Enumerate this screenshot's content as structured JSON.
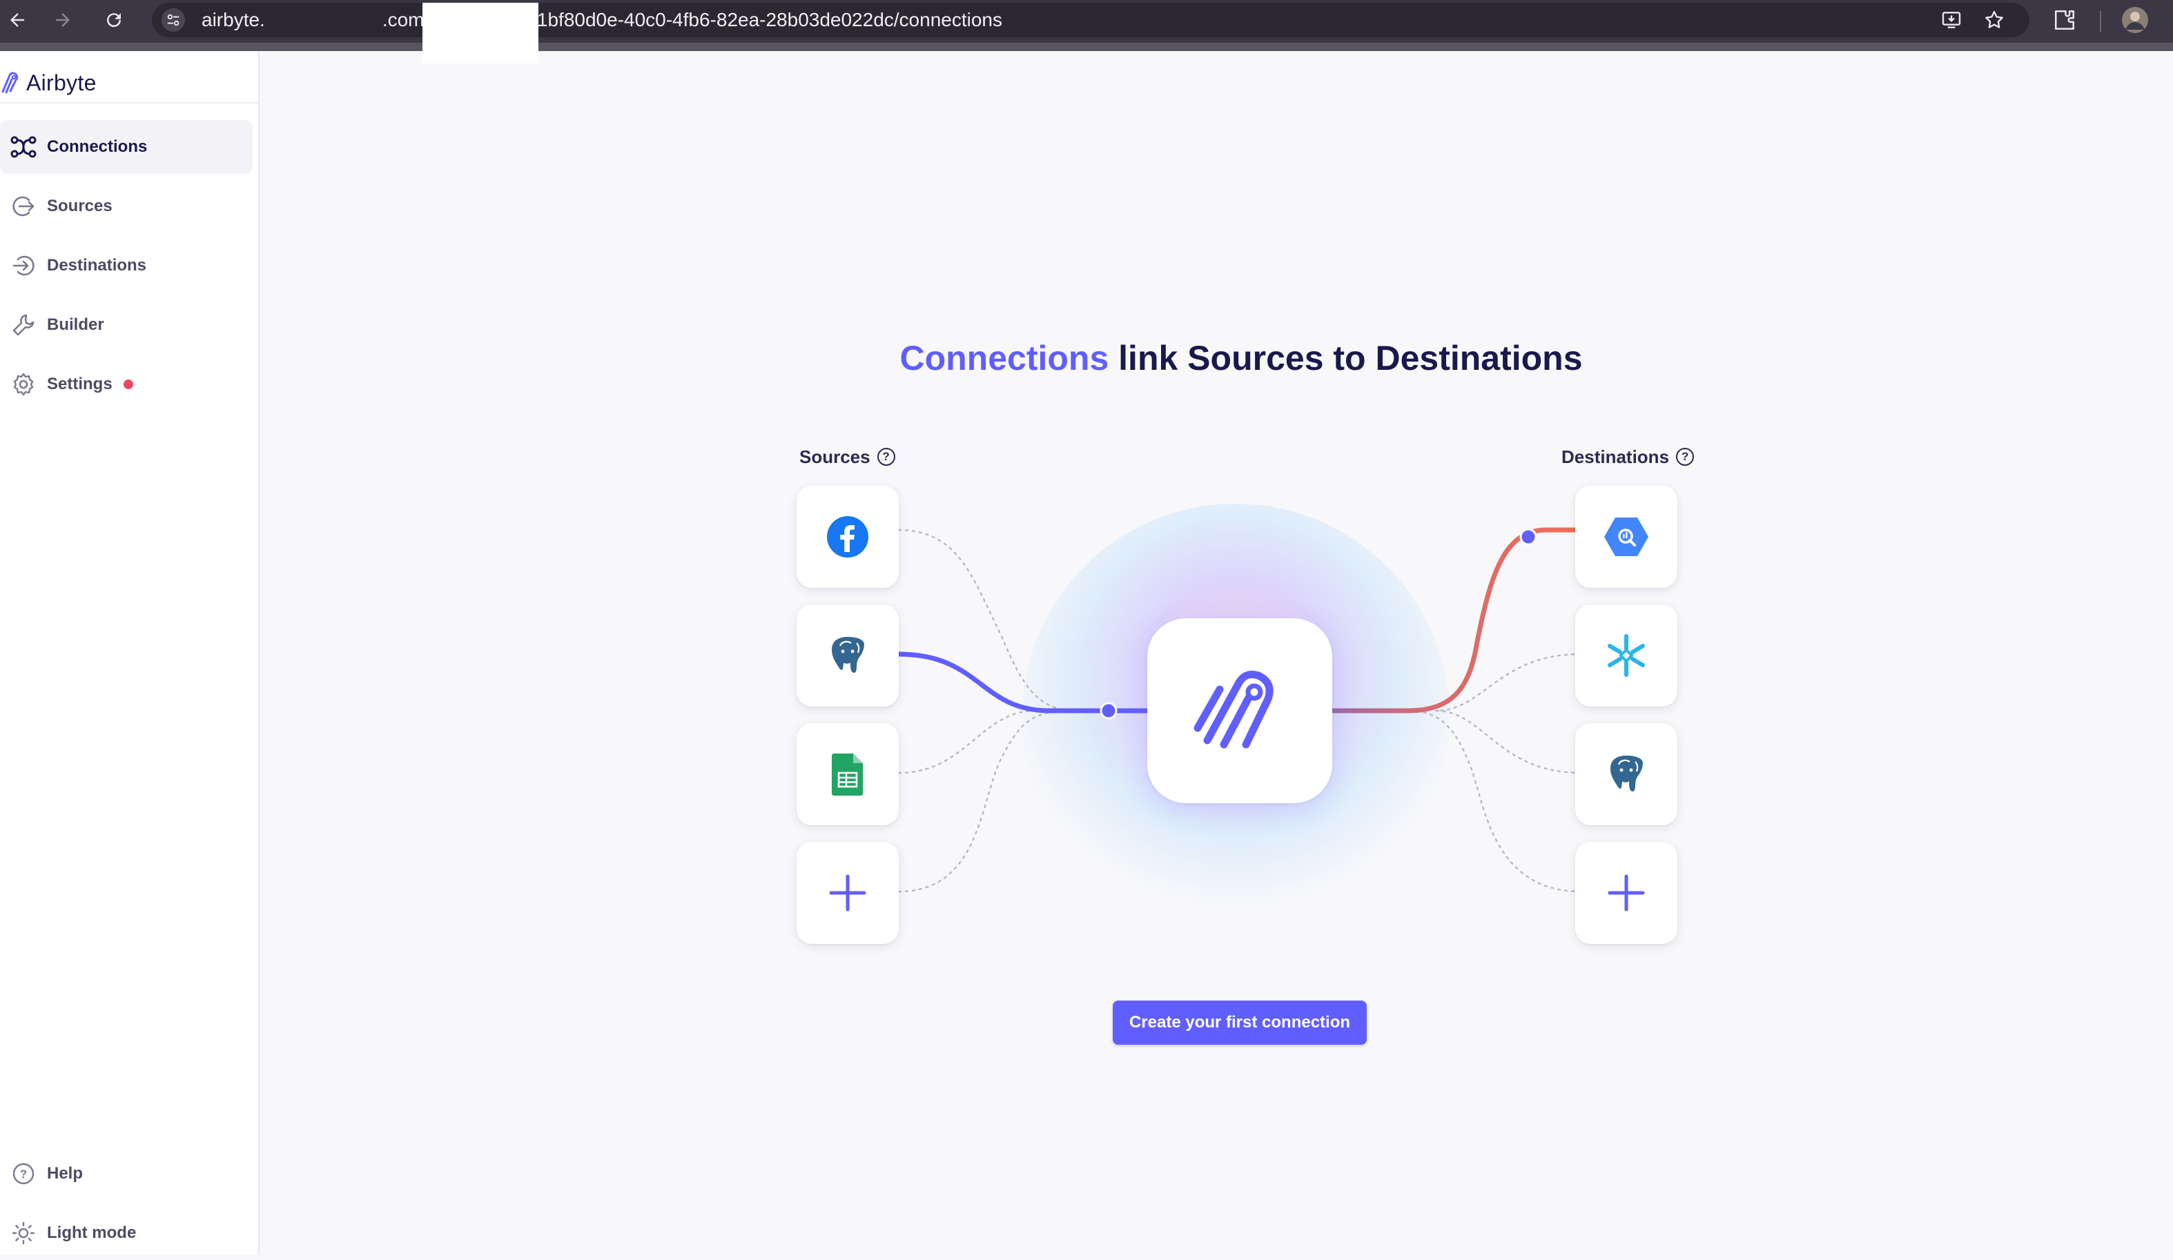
{
  "browser": {
    "url_host": "airbyte.",
    "url_path": ".com/workspaces/1bf80d0e-40c0-4fb6-82ea-28b03de022dc/connections",
    "icons": [
      "back-icon",
      "forward-icon",
      "reload-icon",
      "site-settings-icon",
      "install-app-icon",
      "bookmark-star-icon",
      "extensions-icon",
      "profile-avatar-icon"
    ]
  },
  "sidebar": {
    "brand": "Airbyte",
    "items": [
      {
        "label": "Connections",
        "icon": "connections-icon",
        "active": true
      },
      {
        "label": "Sources",
        "icon": "sources-icon"
      },
      {
        "label": "Destinations",
        "icon": "destinations-icon"
      },
      {
        "label": "Builder",
        "icon": "builder-icon"
      },
      {
        "label": "Settings",
        "icon": "settings-icon",
        "badge": "notification-dot"
      }
    ],
    "footer": [
      {
        "label": "Help",
        "icon": "help-icon"
      },
      {
        "label": "Light mode",
        "icon": "sun-icon"
      }
    ]
  },
  "main": {
    "headline_accent": "Connections",
    "headline_rest": " link Sources to Destinations",
    "sources_label": "Sources",
    "destinations_label": "Destinations",
    "help_glyph": "?",
    "sources": [
      "facebook-icon",
      "postgres-icon",
      "google-sheets-icon",
      "add-source-icon"
    ],
    "destinations": [
      "bigquery-icon",
      "snowflake-icon",
      "postgres-icon",
      "add-destination-icon"
    ],
    "cta_label": "Create your first connection"
  },
  "colors": {
    "accent": "#615eff",
    "source_line": "#615eff",
    "destination_line": "#f06c55",
    "sidebar_text": "#1a194d",
    "settings_badge": "#ec4960"
  }
}
